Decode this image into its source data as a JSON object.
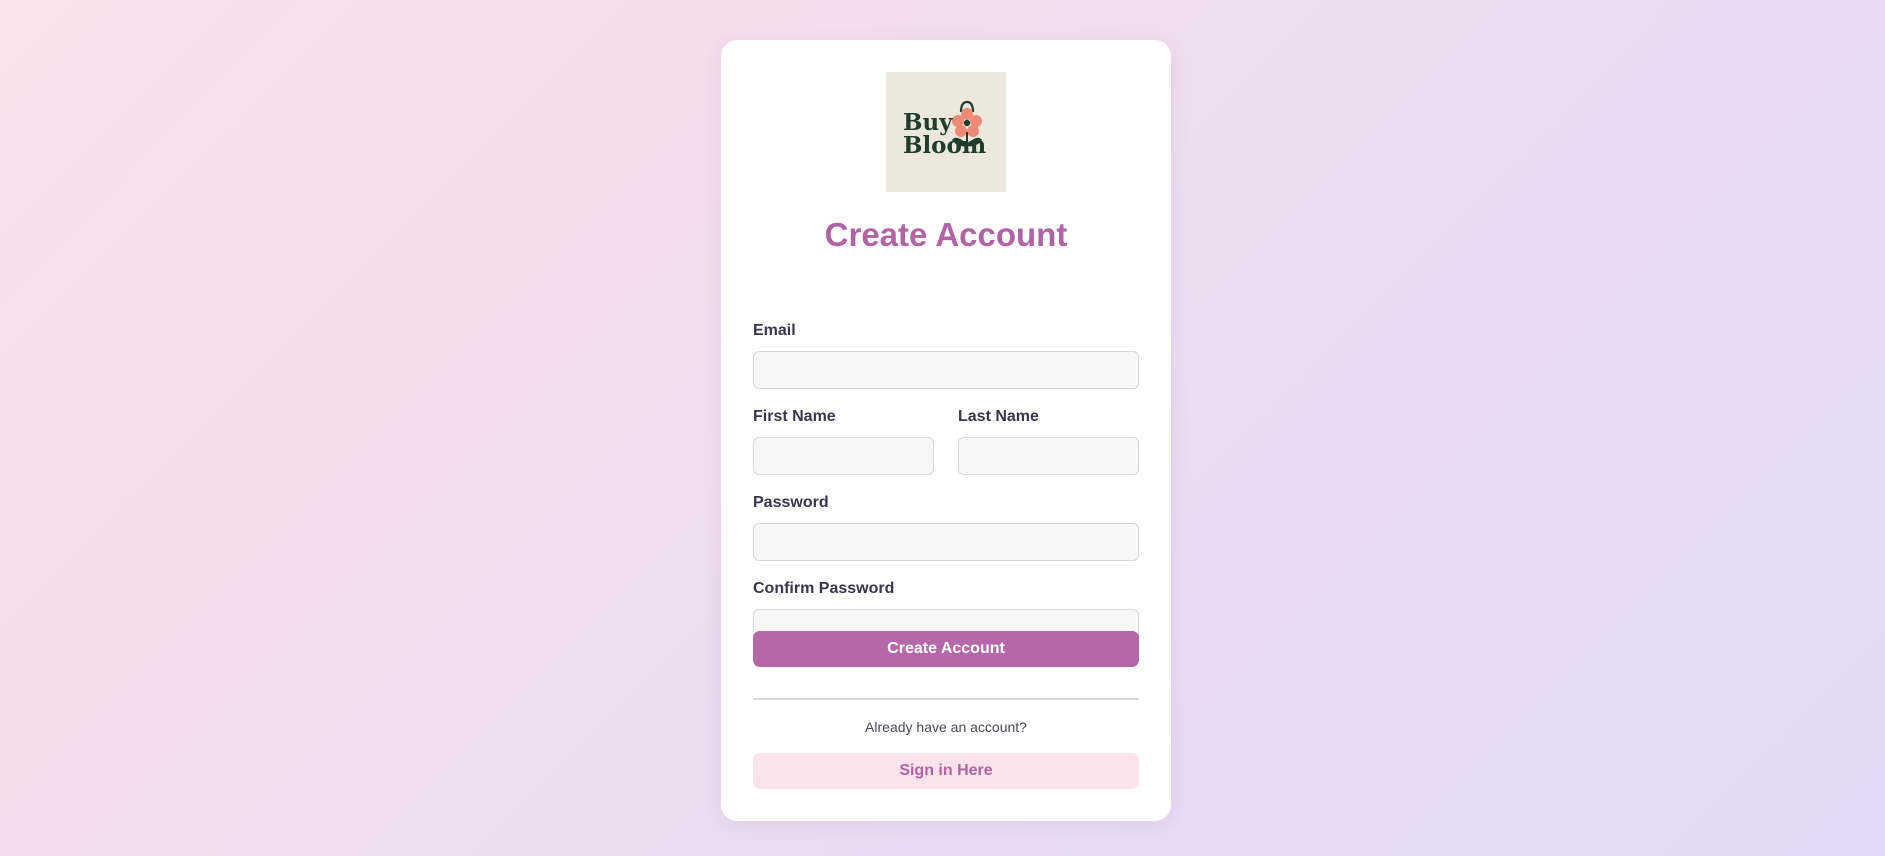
{
  "brand": {
    "logo_text_line1": "Buy",
    "logo_text_line2": "Bloom",
    "logo_icon": "flower-bag-icon",
    "colors": {
      "logo_background": "#ede8dc",
      "logo_text": "#1f3d2b",
      "flower": "#f08a78"
    }
  },
  "form": {
    "title": "Create Account",
    "fields": {
      "email": {
        "label": "Email",
        "value": "",
        "placeholder": ""
      },
      "first_name": {
        "label": "First Name",
        "value": "",
        "placeholder": ""
      },
      "last_name": {
        "label": "Last Name",
        "value": "",
        "placeholder": ""
      },
      "password": {
        "label": "Password",
        "value": "",
        "placeholder": ""
      },
      "confirm_password": {
        "label": "Confirm Password",
        "value": "",
        "placeholder": ""
      }
    },
    "submit_label": "Create Account"
  },
  "signin": {
    "prompt": "Already have an account?",
    "button_label": "Sign in Here"
  },
  "colors": {
    "accent": "#b467a9",
    "secondary_button_bg": "#fce2ea",
    "card_background": "#ffffff"
  }
}
